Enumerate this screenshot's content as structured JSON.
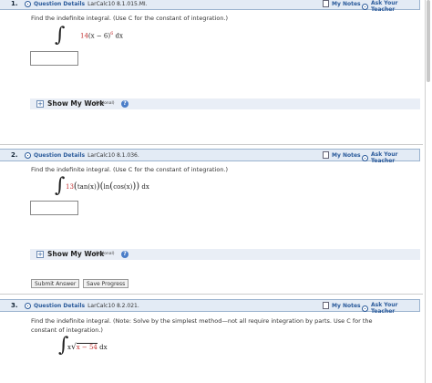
{
  "questions": [
    {
      "number": "1.",
      "details_label": "Question Details",
      "code": "LarCalc10 8.1.015.MI.",
      "notes_label": "My Notes",
      "teacher_label": "Ask Your Teacher",
      "prompt": "Find the indefinite integral. (Use C for the constant of integration.)",
      "integrand_coef": "14",
      "integrand_base": "(x − 6)",
      "integrand_exp": "6",
      "dx": "dx",
      "show_work": "Show My Work",
      "optional": "(Optional)"
    },
    {
      "number": "2.",
      "details_label": "Question Details",
      "code": "LarCalc10 8.1.036.",
      "notes_label": "My Notes",
      "teacher_label": "Ask Your Teacher",
      "prompt": "Find the indefinite integral. (Use C for the constant of integration.)",
      "integrand_coef": "13",
      "integrand_a": "tan(x)",
      "integrand_b_open": "ln",
      "integrand_b_inner": "cos(x)",
      "dx": "dx",
      "show_work": "Show My Work",
      "optional": "(Optional)",
      "submit": "Submit Answer",
      "save": "Save Progress"
    },
    {
      "number": "3.",
      "details_label": "Question Details",
      "code": "LarCalc10 8.2.021.",
      "notes_label": "My Notes",
      "teacher_label": "Ask Your Teacher",
      "prompt_line1": "Find the indefinite integral. (Note: Solve by the simplest method—not all require integration by parts. Use C for the",
      "prompt_line2": "constant of integration.)",
      "integrand_x": "x",
      "radicand": "x − 54",
      "dx": "dx"
    }
  ],
  "colors": {
    "header_bg": "#e3ebf5",
    "accent": "#2a5a9a",
    "red": "#c23030"
  }
}
